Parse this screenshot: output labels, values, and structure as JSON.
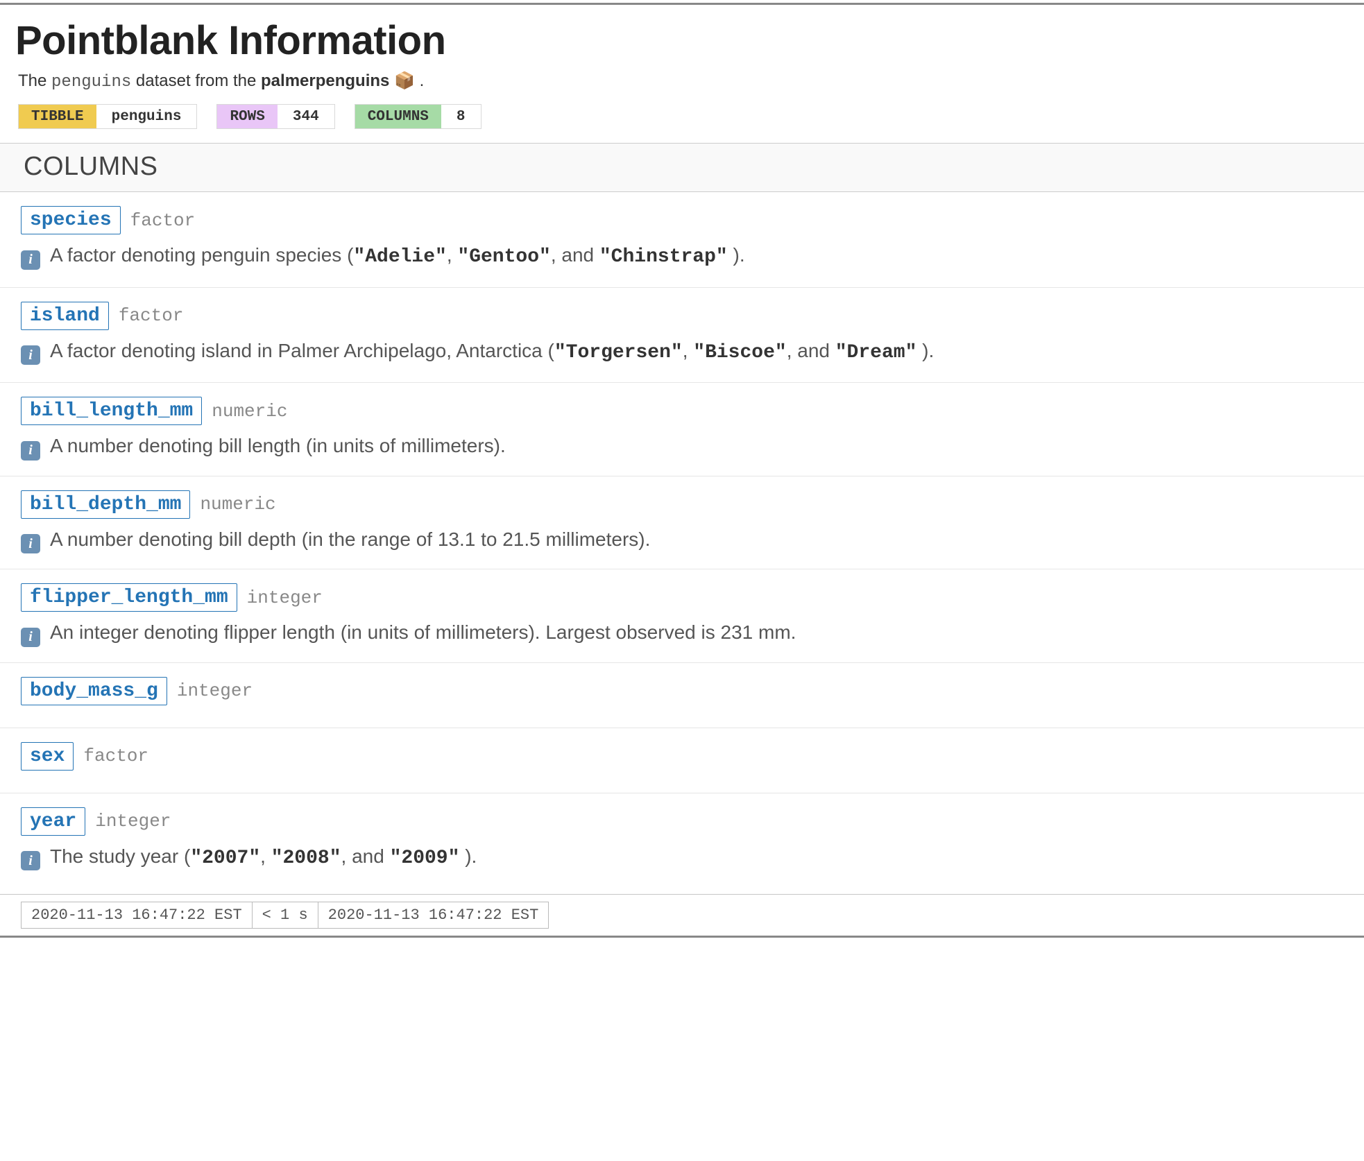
{
  "header": {
    "title": "Pointblank Information",
    "subtitle_prefix": "The ",
    "subtitle_dataset": "penguins",
    "subtitle_middle": " dataset from the ",
    "subtitle_package": "palmerpenguins",
    "subtitle_emoji": " 📦 ",
    "subtitle_suffix": "."
  },
  "pills": {
    "tibble": {
      "label": "TIBBLE",
      "value": "penguins"
    },
    "rows": {
      "label": "ROWS",
      "value": "344"
    },
    "cols": {
      "label": "COLUMNS",
      "value": "8"
    }
  },
  "section_label": "COLUMNS",
  "info_glyph": "i",
  "columns": [
    {
      "name": "species",
      "type": "factor",
      "has_desc": true,
      "desc_parts": [
        {
          "t": "text",
          "v": "A factor denoting penguin species ("
        },
        {
          "t": "code",
          "v": "\"Adelie\""
        },
        {
          "t": "text",
          "v": ", "
        },
        {
          "t": "code",
          "v": "\"Gentoo\""
        },
        {
          "t": "text",
          "v": ", and "
        },
        {
          "t": "code",
          "v": "\"Chinstrap\""
        },
        {
          "t": "text",
          "v": " )."
        }
      ]
    },
    {
      "name": "island",
      "type": "factor",
      "has_desc": true,
      "desc_parts": [
        {
          "t": "text",
          "v": "A factor denoting island in Palmer Archipelago, Antarctica ("
        },
        {
          "t": "code",
          "v": "\"Torgersen\""
        },
        {
          "t": "text",
          "v": ", "
        },
        {
          "t": "code",
          "v": "\"Biscoe\""
        },
        {
          "t": "text",
          "v": ", and "
        },
        {
          "t": "code",
          "v": "\"Dream\""
        },
        {
          "t": "text",
          "v": " )."
        }
      ]
    },
    {
      "name": "bill_length_mm",
      "type": "numeric",
      "has_desc": true,
      "desc_parts": [
        {
          "t": "text",
          "v": "A number denoting bill length (in units of millimeters)."
        }
      ]
    },
    {
      "name": "bill_depth_mm",
      "type": "numeric",
      "has_desc": true,
      "desc_parts": [
        {
          "t": "text",
          "v": "A number denoting bill depth (in the range of 13.1 to 21.5 millimeters)."
        }
      ]
    },
    {
      "name": "flipper_length_mm",
      "type": "integer",
      "has_desc": true,
      "desc_parts": [
        {
          "t": "text",
          "v": "An integer denoting flipper length (in units of millimeters). Largest observed is 231 mm."
        }
      ]
    },
    {
      "name": "body_mass_g",
      "type": "integer",
      "has_desc": false,
      "desc_parts": []
    },
    {
      "name": "sex",
      "type": "factor",
      "has_desc": false,
      "desc_parts": []
    },
    {
      "name": "year",
      "type": "integer",
      "has_desc": true,
      "desc_parts": [
        {
          "t": "text",
          "v": "The study year ("
        },
        {
          "t": "code",
          "v": "\"2007\""
        },
        {
          "t": "text",
          "v": ", "
        },
        {
          "t": "code",
          "v": "\"2008\""
        },
        {
          "t": "text",
          "v": ", and "
        },
        {
          "t": "code",
          "v": "\"2009\""
        },
        {
          "t": "text",
          "v": " )."
        }
      ]
    }
  ],
  "footer": {
    "start_time": "2020-11-13 16:47:22 EST",
    "duration": "< 1 s",
    "end_time": "2020-11-13 16:47:22 EST"
  }
}
